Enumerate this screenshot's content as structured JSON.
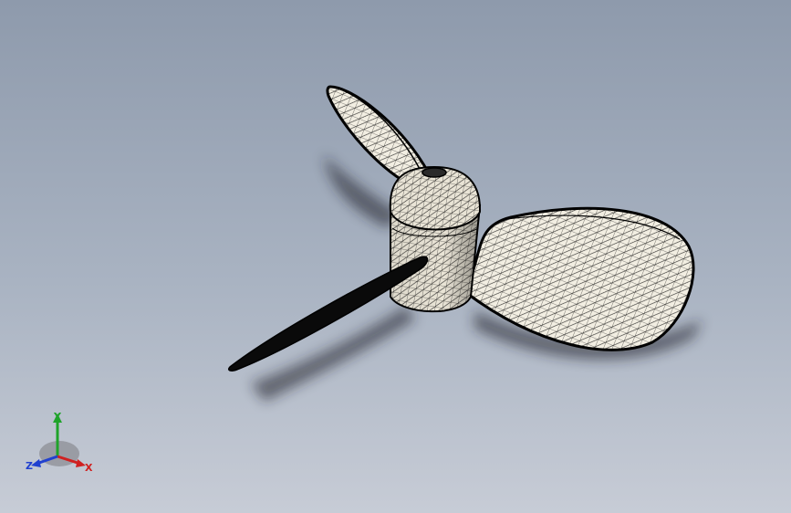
{
  "viewport": {
    "background_top": "#8e9aac",
    "background_bottom": "#c7ccd6"
  },
  "model": {
    "blade_color": "#f2eee2",
    "mesh_color": "#111111",
    "hub_color": "#e9e4d6"
  },
  "triad": {
    "x_label": "X",
    "y_label": "Y",
    "z_label": "Z",
    "x_color": "#d02020",
    "y_color": "#1fa32a",
    "z_color": "#2040d0"
  }
}
